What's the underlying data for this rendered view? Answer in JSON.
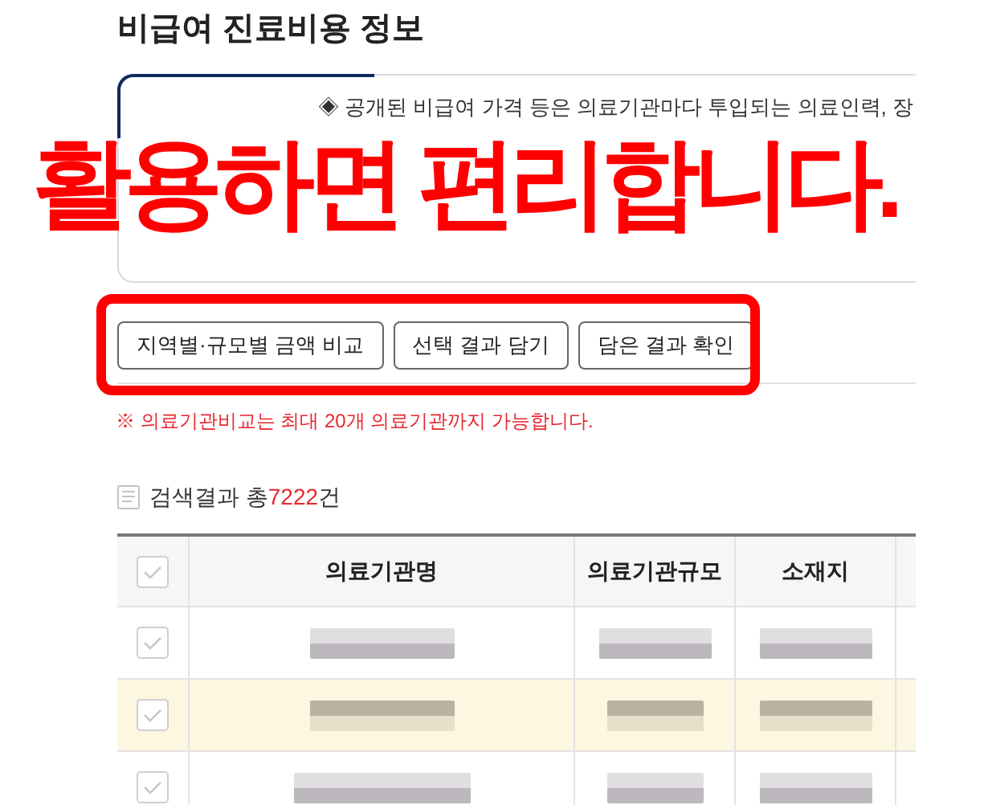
{
  "page_title": "비급여 진료비용 정보",
  "notice": {
    "lines": [
      "◈ 공개된 비급여 가격 등은 의료기관마다 투입되는 의료인력, 장"
    ]
  },
  "overlay_caption": "활용하면 편리합니다.",
  "buttons": [
    "지역별·규모별 금액 비교",
    "선택 결과 담기",
    "담은 결과 확인"
  ],
  "compare_note": "※ 의료기관비교는 최대 20개 의료기관까지 가능합니다.",
  "results": {
    "prefix": "검색결과 총",
    "count": "7222",
    "suffix": "건"
  },
  "table": {
    "columns": [
      "의료기관명",
      "의료기관규모",
      "소재지"
    ],
    "all_checked": false,
    "rows": [
      {
        "selected": false,
        "checked": false
      },
      {
        "selected": true,
        "checked": false
      },
      {
        "selected": false,
        "checked": false
      }
    ]
  }
}
